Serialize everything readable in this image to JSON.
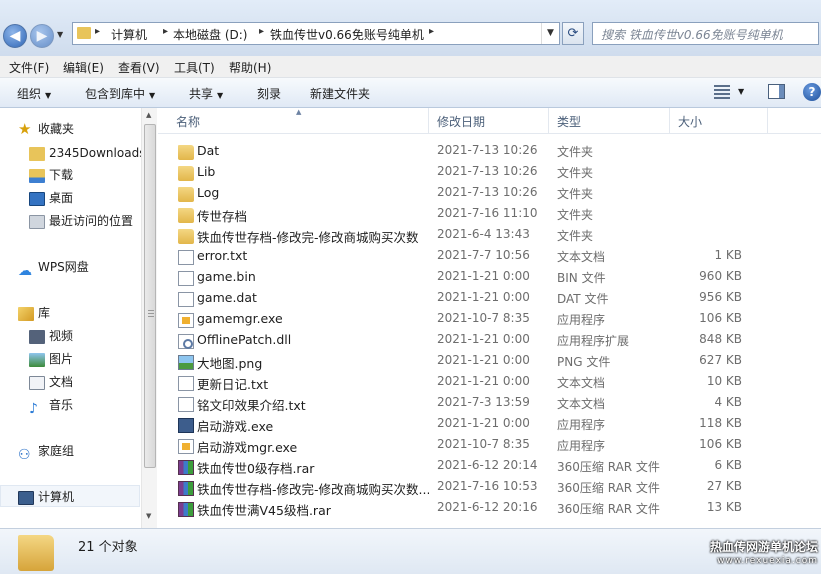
{
  "address_bar": {
    "breadcrumbs": [
      "计算机",
      "本地磁盘 (D:)",
      "铁血传世v0.66免账号纯单机"
    ],
    "search_placeholder": "搜索 铁血传世v0.66免账号纯单机"
  },
  "menu": [
    "文件(F)",
    "编辑(E)",
    "查看(V)",
    "工具(T)",
    "帮助(H)"
  ],
  "commands": {
    "organize": "组织",
    "include_in_library": "包含到库中",
    "share": "共享",
    "burn": "刻录",
    "new_folder": "新建文件夹"
  },
  "nav": {
    "favorites": "收藏夹",
    "fav_items": [
      "2345Downloads",
      "下载",
      "桌面",
      "最近访问的位置"
    ],
    "wps": "WPS网盘",
    "libraries": "库",
    "lib_items": [
      "视频",
      "图片",
      "文档",
      "音乐"
    ],
    "homegroup": "家庭组",
    "computer": "计算机"
  },
  "columns": {
    "name": "名称",
    "date": "修改日期",
    "type": "类型",
    "size": "大小"
  },
  "files": [
    {
      "icon": "folder-icon",
      "name": "Dat",
      "date": "2021-7-13 10:26",
      "type": "文件夹",
      "size": ""
    },
    {
      "icon": "folder-icon",
      "name": "Lib",
      "date": "2021-7-13 10:26",
      "type": "文件夹",
      "size": ""
    },
    {
      "icon": "folder-icon",
      "name": "Log",
      "date": "2021-7-13 10:26",
      "type": "文件夹",
      "size": ""
    },
    {
      "icon": "folder-icon",
      "name": "传世存档",
      "date": "2021-7-16 11:10",
      "type": "文件夹",
      "size": ""
    },
    {
      "icon": "folder-icon",
      "name": "铁血传世存档-修改完-修改商城购买次数",
      "date": "2021-6-4 13:43",
      "type": "文件夹",
      "size": ""
    },
    {
      "icon": "text-file-icon",
      "name": "error.txt",
      "date": "2021-7-7 10:56",
      "type": "文本文档",
      "size": "1 KB"
    },
    {
      "icon": "text-file-icon",
      "name": "game.bin",
      "date": "2021-1-21 0:00",
      "type": "BIN 文件",
      "size": "960 KB"
    },
    {
      "icon": "text-file-icon",
      "name": "game.dat",
      "date": "2021-1-21 0:00",
      "type": "DAT 文件",
      "size": "956 KB"
    },
    {
      "icon": "exe-icon",
      "name": "gamemgr.exe",
      "date": "2021-10-7 8:35",
      "type": "应用程序",
      "size": "106 KB"
    },
    {
      "icon": "dll-icon",
      "name": "OfflinePatch.dll",
      "date": "2021-1-21 0:00",
      "type": "应用程序扩展",
      "size": "848 KB"
    },
    {
      "icon": "image-icon",
      "name": "大地图.png",
      "date": "2021-1-21 0:00",
      "type": "PNG 文件",
      "size": "627 KB"
    },
    {
      "icon": "text-file-icon",
      "name": "更新日记.txt",
      "date": "2021-1-21 0:00",
      "type": "文本文档",
      "size": "10 KB"
    },
    {
      "icon": "text-file-icon",
      "name": "铭文印效果介绍.txt",
      "date": "2021-7-3 13:59",
      "type": "文本文档",
      "size": "4 KB"
    },
    {
      "icon": "app-icon",
      "name": "启动游戏.exe",
      "date": "2021-1-21 0:00",
      "type": "应用程序",
      "size": "118 KB"
    },
    {
      "icon": "exe-icon",
      "name": "启动游戏mgr.exe",
      "date": "2021-10-7 8:35",
      "type": "应用程序",
      "size": "106 KB"
    },
    {
      "icon": "rar-icon",
      "name": "铁血传世0级存档.rar",
      "date": "2021-6-12 20:14",
      "type": "360压缩 RAR 文件",
      "size": "6 KB"
    },
    {
      "icon": "rar-icon",
      "name": "铁血传世存档-修改完-修改商城购买次数...",
      "date": "2021-7-16 10:53",
      "type": "360压缩 RAR 文件",
      "size": "27 KB"
    },
    {
      "icon": "rar-icon",
      "name": "铁血传世满V45级档.rar",
      "date": "2021-6-12 20:16",
      "type": "360压缩 RAR 文件",
      "size": "13 KB"
    }
  ],
  "status": {
    "count": "21 个对象",
    "watermark": "热血传网游单机论坛",
    "watermark_url": "www.rexuexia.com"
  }
}
